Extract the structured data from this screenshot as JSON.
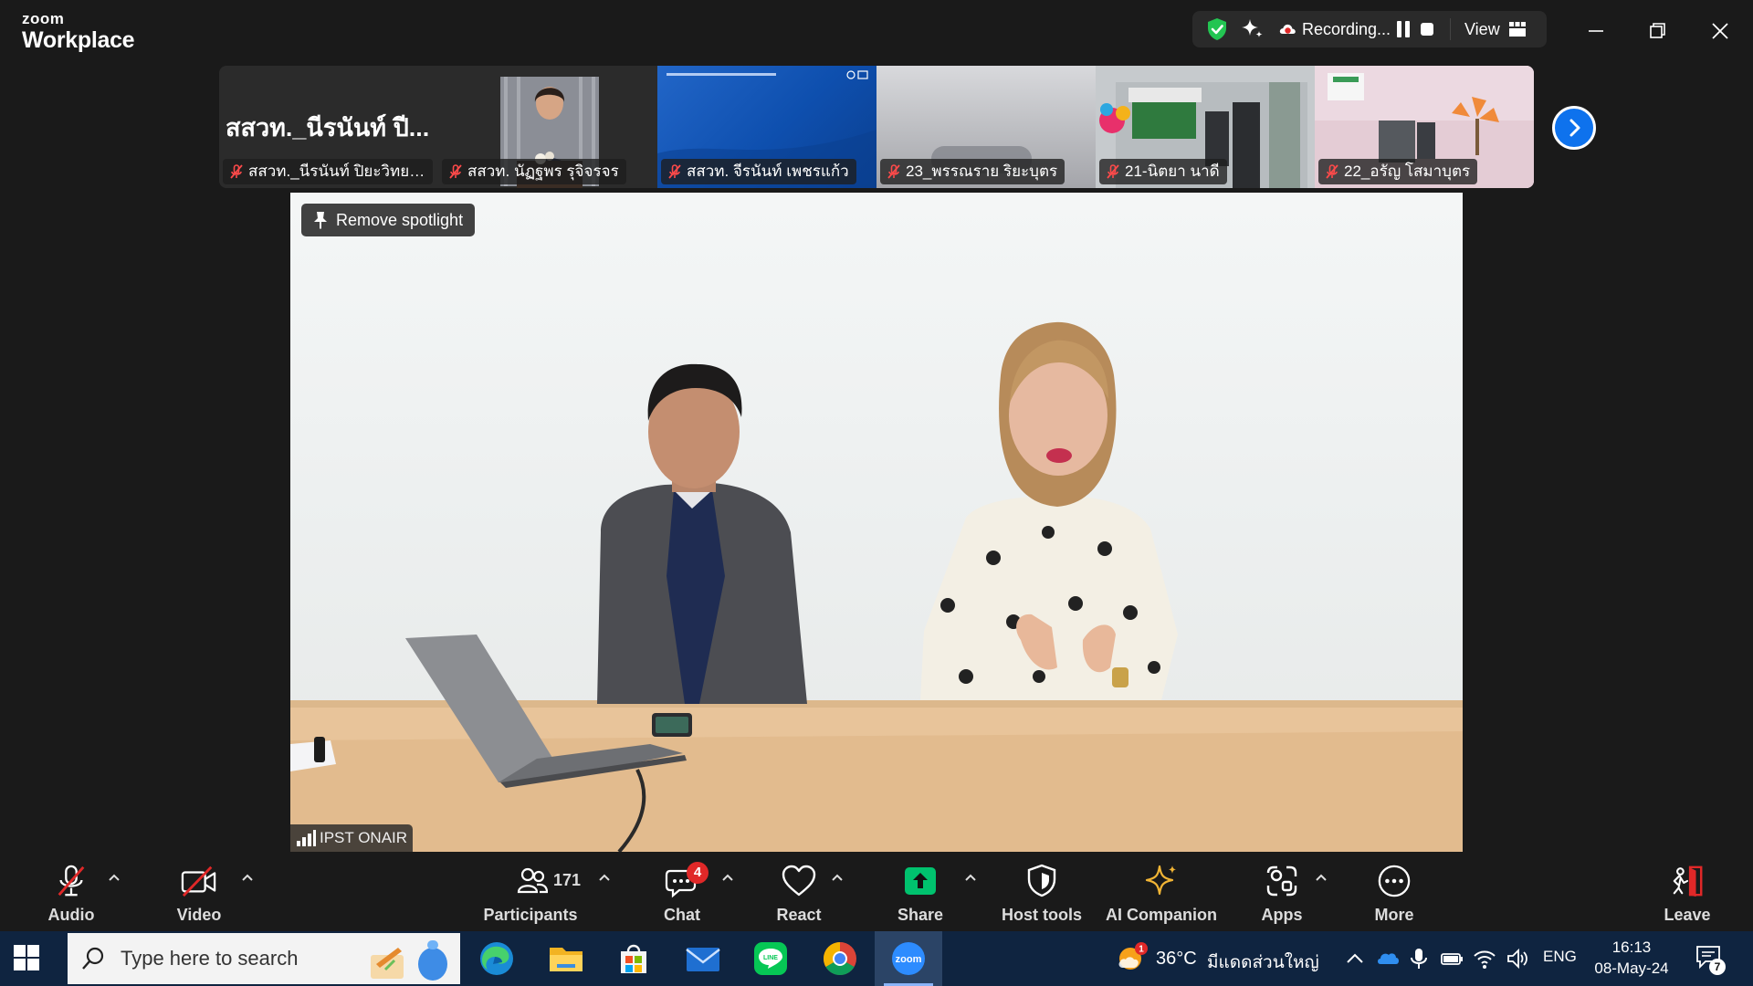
{
  "app": {
    "brand_top": "zoom",
    "brand_bottom": "Workplace"
  },
  "recording": {
    "status": "Recording...",
    "view_label": "View"
  },
  "thumbnails": {
    "first_big_name": "สสวท._นีรนันท์ ปี...",
    "items": [
      {
        "name": "สสวท._นีรนันท์ ปิยะวิทยาธ..."
      },
      {
        "name": "สสวท. นัฏฐพร รุจิจรจร"
      },
      {
        "name": "สสวท. จีรนันท์ เพชรแก้ว"
      },
      {
        "name": "23_พรรณราย ริยะบุตร"
      },
      {
        "name": "21-นิตยา นาดี"
      },
      {
        "name": "22_อรัญ โสมาบุตร"
      }
    ]
  },
  "main_video": {
    "spotlight_label": "Remove spotlight",
    "participant_name": "IPST ONAIR"
  },
  "controls": {
    "audio": "Audio",
    "video": "Video",
    "participants": "Participants",
    "participants_count": "171",
    "chat": "Chat",
    "chat_badge": "4",
    "react": "React",
    "share": "Share",
    "host_tools": "Host tools",
    "ai_companion": "AI Companion",
    "apps": "Apps",
    "more": "More",
    "leave": "Leave"
  },
  "taskbar": {
    "search_placeholder": "Type here to search",
    "weather_temp": "36°C",
    "weather_desc": "มีแดดส่วนใหญ่",
    "weather_badge": "1",
    "language": "ENG",
    "time": "16:13",
    "date": "08-May-24",
    "notification_count": "7"
  },
  "colors": {
    "accent_blue": "#0e72ed",
    "share_green": "#00c26e",
    "muted_red": "#e02828",
    "taskbar": "#0f2440",
    "toolbar_bg": "#1a1a1a"
  }
}
